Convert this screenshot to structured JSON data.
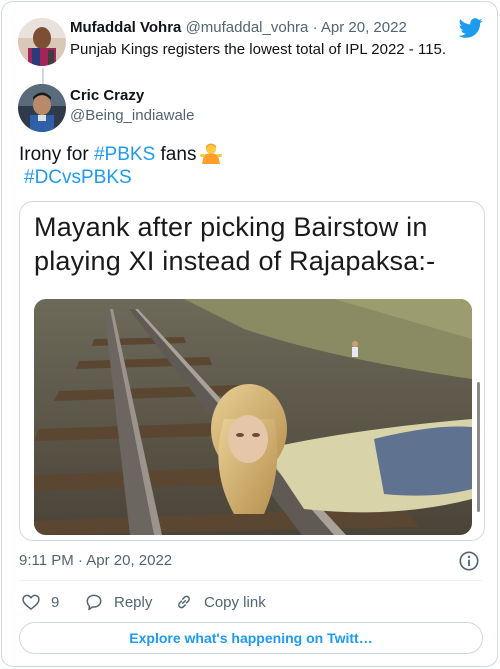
{
  "quoted_tweet": {
    "name": "Mufaddal Vohra",
    "handle": "@mufaddal_vohra",
    "separator": "·",
    "date": "Apr 20, 2022",
    "text": "Punjab Kings registers the lowest total of IPL 2022 - 115."
  },
  "tweet": {
    "name": "Cric Crazy",
    "handle": "@Being_indiawale",
    "text_prefix": "Irony for ",
    "hashtag1": "#PBKS",
    "text_middle": " fans",
    "emoji": "person-shrugging-emoji",
    "hashtag2": "#DCvsPBKS",
    "timestamp": "9:11 PM · Apr 20, 2022"
  },
  "media": {
    "caption_line1": "Mayank after picking Bairstow in",
    "caption_line2": "playing XI instead of Rajapaksa:-"
  },
  "actions": {
    "like_count": "9",
    "reply_label": "Reply",
    "copy_label": "Copy link"
  },
  "explore_label": "Explore what's happening on Twitt…",
  "icons": {
    "brand": "twitter-bird-icon",
    "info": "info-icon",
    "like": "heart-icon",
    "reply": "reply-bubble-icon",
    "copy": "link-icon"
  },
  "colors": {
    "accent": "#1d9bf0",
    "text": "#0f1419",
    "secondary": "#536471",
    "border": "#cfd9de"
  }
}
